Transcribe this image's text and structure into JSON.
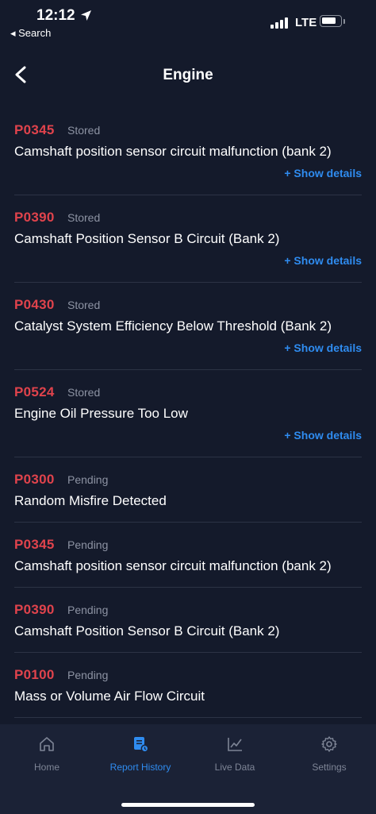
{
  "status_bar": {
    "time": "12:12",
    "back_app": "◂ Search",
    "network": "LTE"
  },
  "header": {
    "title": "Engine"
  },
  "show_details_label": "+ Show details",
  "codes": [
    {
      "code": "P0345",
      "state": "Stored",
      "description": "Camshaft position sensor circuit malfunction (bank 2)",
      "has_details": true
    },
    {
      "code": "P0390",
      "state": "Stored",
      "description": "Camshaft Position Sensor B Circuit (Bank 2)",
      "has_details": true
    },
    {
      "code": "P0430",
      "state": "Stored",
      "description": "Catalyst System Efficiency Below Threshold (Bank 2)",
      "has_details": true
    },
    {
      "code": "P0524",
      "state": "Stored",
      "description": "Engine Oil Pressure Too Low",
      "has_details": true
    },
    {
      "code": "P0300",
      "state": "Pending",
      "description": "Random Misfire Detected",
      "has_details": false
    },
    {
      "code": "P0345",
      "state": "Pending",
      "description": "Camshaft position sensor circuit malfunction (bank 2)",
      "has_details": false
    },
    {
      "code": "P0390",
      "state": "Pending",
      "description": "Camshaft Position Sensor B Circuit (Bank 2)",
      "has_details": false
    },
    {
      "code": "P0100",
      "state": "Pending",
      "description": "Mass or Volume Air Flow Circuit",
      "has_details": false
    }
  ],
  "tabs": [
    {
      "label": "Home",
      "icon": "home-icon",
      "active": false
    },
    {
      "label": "Report History",
      "icon": "report-icon",
      "active": true
    },
    {
      "label": "Live Data",
      "icon": "chart-icon",
      "active": false
    },
    {
      "label": "Settings",
      "icon": "gear-icon",
      "active": false
    }
  ],
  "colors": {
    "background": "#141a2b",
    "code_red": "#e0434c",
    "accent_blue": "#2f8cf0",
    "muted": "#8d93a3"
  }
}
